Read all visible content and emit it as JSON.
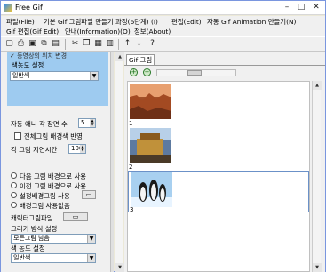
{
  "window": {
    "title": "Free Gif",
    "minimize": "–",
    "maximize": "□",
    "close": "✕"
  },
  "menus": {
    "file": "파일(File)",
    "basic": "기본 Gif 그림파일 만들기 과정(6단계) (I)",
    "edit": "편집(Edit)",
    "auto": "자동 Gif Animation 만들기(N)",
    "gif_edit": "Gif 편집(Gif Edit)",
    "info": "안내(Information)(O)",
    "about": "정보(About)"
  },
  "toolbar_icons": [
    "new-icon",
    "print-icon",
    "save-icon",
    "copy-frames-icon",
    "paste-frames-icon",
    "cut-icon",
    "copy-icon",
    "paste-icon",
    "delete-icon",
    "up-arrow-icon",
    "down-arrow-icon",
    "info-icon"
  ],
  "left": {
    "partial_top": "✓ 동영상의 위치 변경",
    "color_setting_label": "색농도 설정",
    "color_value": "일반색",
    "auto_frame_label": "자동 애니 각 장면 수",
    "auto_frame_value": "5",
    "full_bg_label": "전체그림 배경색 반영",
    "delay_label": "각 그림 지연시간",
    "delay_value": "100",
    "radio_next": "다음 그림 배경으로 사용",
    "radio_prev": "이전 그림 배경으로 사용",
    "radio_set": "설정배경그림 사용",
    "radio_bg": "배경그림 사용없음",
    "char_file_label": "캐릭터그림파일",
    "draw_method_label": "그리기 방식 설정",
    "draw_method_value": "모든그림 남음",
    "color_setting2_label": "색 농도 설정",
    "color_value2": "일반색"
  },
  "right": {
    "tab_label": "Gif 그림",
    "items": [
      {
        "number": "1"
      },
      {
        "number": "2"
      },
      {
        "number": "3"
      }
    ]
  }
}
